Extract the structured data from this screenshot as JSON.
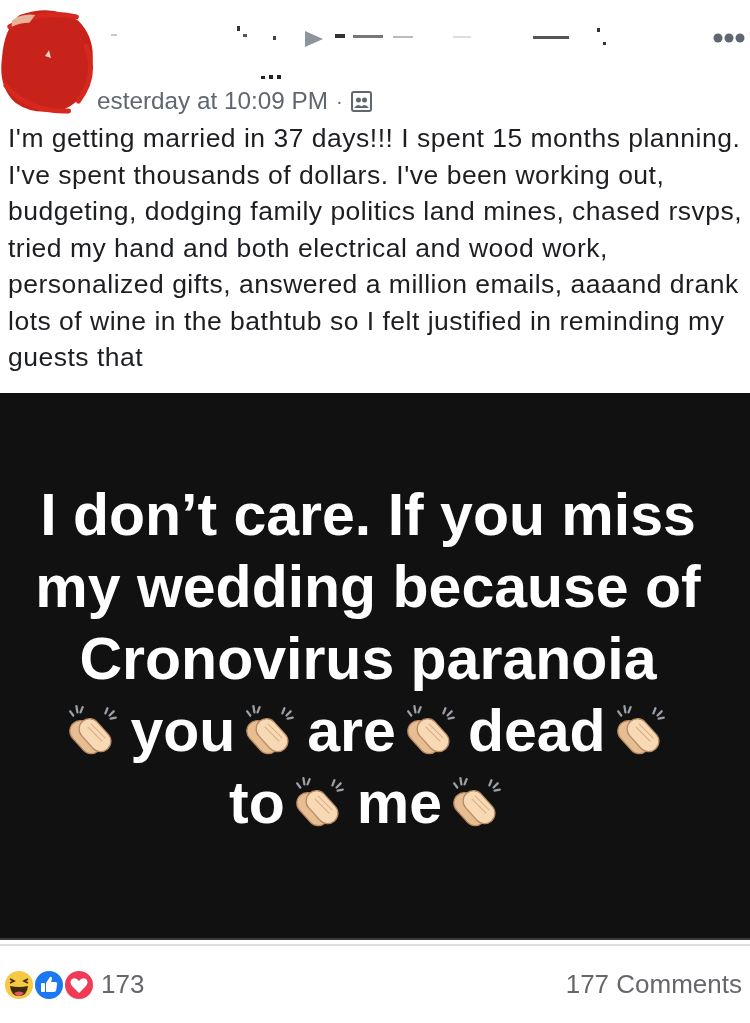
{
  "header": {
    "timestamp": "esterday at 10:09 PM",
    "separator": "·"
  },
  "body": "I'm getting married in 37 days!!! I spent 15 months planning. I've spent thousands of dollars. I've been working out, budgeting, dodging family politics land mines, chased rsvps, tried my hand and both electrical and wood work, personalized gifts, answered a million emails, aaaand drank lots of wine in the bathtub so I felt justified in reminding my guests that",
  "image": {
    "lines": [
      {
        "tokens": [
          {
            "kind": "text",
            "text": "I don’t care. If you miss"
          }
        ]
      },
      {
        "tokens": [
          {
            "kind": "text",
            "text": "my wedding because of"
          }
        ]
      },
      {
        "tokens": [
          {
            "kind": "text",
            "text": "Cronovirus paranoia"
          }
        ]
      },
      {
        "tokens": [
          {
            "kind": "clap"
          },
          {
            "kind": "text",
            "text": "you"
          },
          {
            "kind": "clap"
          },
          {
            "kind": "text",
            "text": "are"
          },
          {
            "kind": "clap"
          },
          {
            "kind": "text",
            "text": "dead"
          },
          {
            "kind": "clap"
          }
        ]
      },
      {
        "tokens": [
          {
            "kind": "text",
            "text": "to"
          },
          {
            "kind": "clap"
          },
          {
            "kind": "text",
            "text": "me"
          },
          {
            "kind": "clap"
          }
        ]
      }
    ]
  },
  "footer": {
    "reactions": [
      {
        "kind": "haha"
      },
      {
        "kind": "like"
      },
      {
        "kind": "love"
      }
    ],
    "reaction_count": "173",
    "comments": "177 Comments"
  }
}
